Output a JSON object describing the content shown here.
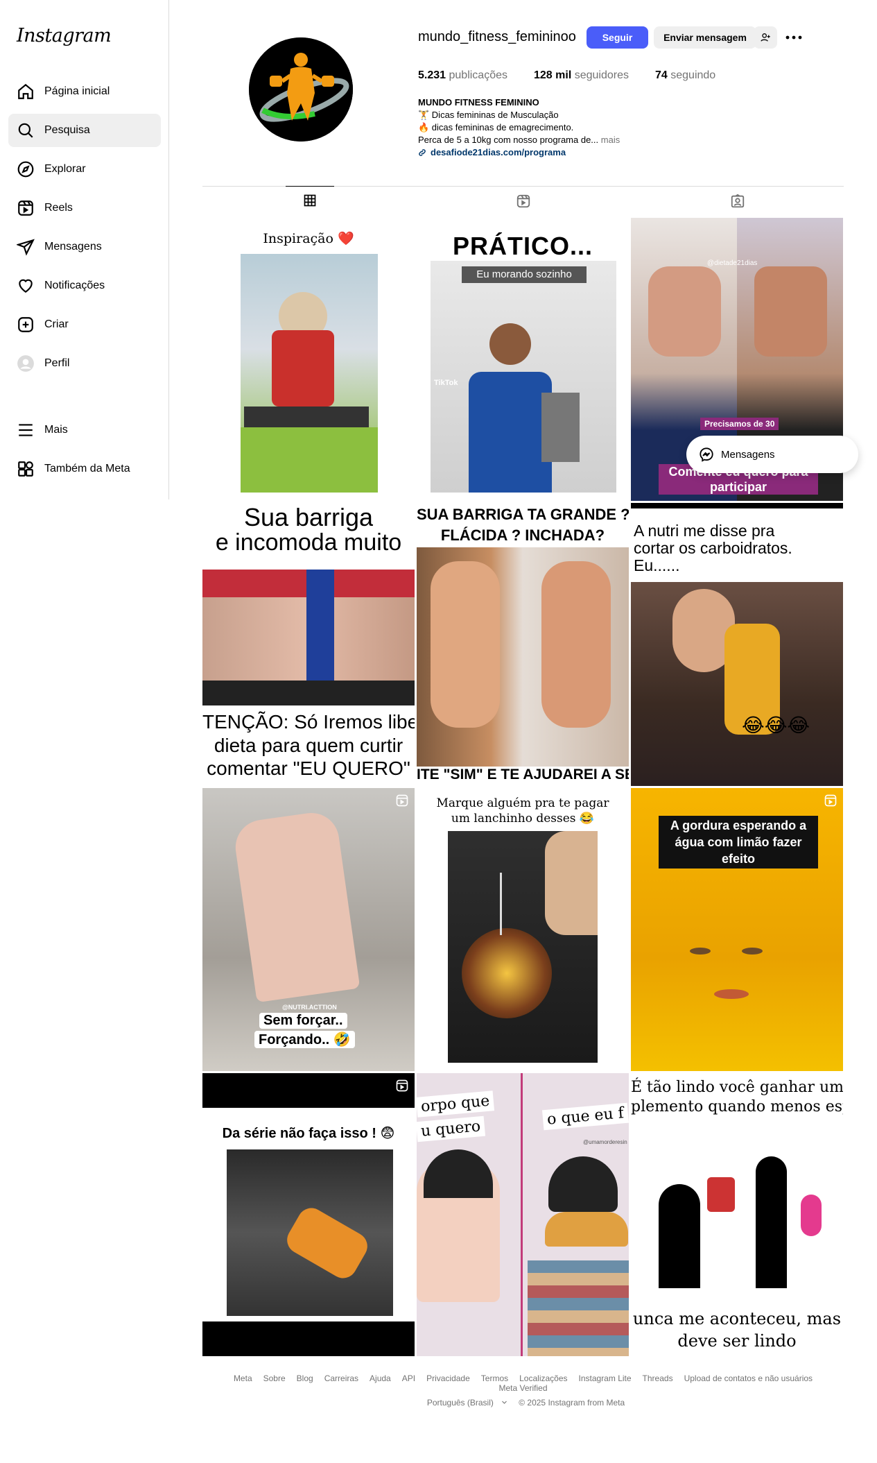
{
  "app": {
    "logo": "Instagram"
  },
  "sidebar": {
    "items": [
      {
        "label": "Página inicial",
        "icon": "home-icon"
      },
      {
        "label": "Pesquisa",
        "icon": "search-icon",
        "active": true
      },
      {
        "label": "Explorar",
        "icon": "compass-icon"
      },
      {
        "label": "Reels",
        "icon": "reels-icon"
      },
      {
        "label": "Mensagens",
        "icon": "paper-plane-icon"
      },
      {
        "label": "Notificações",
        "icon": "heart-icon"
      },
      {
        "label": "Criar",
        "icon": "plus-square-icon"
      },
      {
        "label": "Perfil",
        "icon": "avatar-icon"
      }
    ],
    "bottom": [
      {
        "label": "Mais",
        "icon": "menu-icon"
      },
      {
        "label": "Também da Meta",
        "icon": "meta-grid-icon"
      }
    ]
  },
  "profile": {
    "username": "mundo_fitness_femininoo",
    "follow_label": "Seguir",
    "message_label": "Enviar mensagem",
    "stats": {
      "posts_value": "5.231",
      "posts_label": "publicações",
      "followers_value": "128 mil",
      "followers_label": "seguidores",
      "following_value": "74",
      "following_label": "seguindo"
    },
    "bio": {
      "name": "MUNDO FITNESS FEMININO",
      "line1": "🏋️ Dicas femininas de Musculação",
      "line2": "🔥 dicas femininas de emagrecimento.",
      "line3": "Perca de 5 a 10kg com nosso programa de...",
      "more": "mais",
      "link": "desafiode21dias.com/programa"
    }
  },
  "posts": [
    {
      "caption": "Inspiração ❤️"
    },
    {
      "caption": "PRÁTICO...",
      "sub": "Eu morando sozinho",
      "tag": "TikTok"
    },
    {
      "caption": "@dietade21dias",
      "overlay1": "Precisamos de 30",
      "overlay2": "Comente eu quero para participar"
    },
    {
      "caption": "Sua barriga",
      "line2": "e incomoda muito",
      "bottom1": "TENÇÃO: Só Iremos liber",
      "bottom2": "dieta para quem curtir",
      "bottom3": "comentar \"EU QUERO\""
    },
    {
      "caption": "SUA BARRIGA TA GRANDE ?",
      "line2": "FLÁCIDA ? INCHADA?",
      "bottom1": "ITE \"SIM\" E TE AJUDAREI A SEC"
    },
    {
      "caption": "A nutri me disse pra",
      "line2": "cortar os carboidratos.",
      "line3": "Eu......",
      "emoji": "😂😂😂"
    },
    {
      "tag": "@NUTRI.ACTTION",
      "caption": "Sem forçar..",
      "line2": "Forçando.. 🤣"
    },
    {
      "caption": "Marque alguém pra te pagar",
      "line2": "um lanchinho desses 😂"
    },
    {
      "caption": "A gordura esperando a",
      "line2": "água com limão fazer efeito"
    },
    {
      "caption": "Da série não faça isso ! 😨"
    },
    {
      "caption": "orpo que",
      "line2": "u quero",
      "right": "o que eu f",
      "tag": "@umamorderesin"
    },
    {
      "caption": "É tão lindo você ganhar um",
      "line2": "plemento quando menos espe",
      "bottom1": "unca me aconteceu, mas",
      "bottom2": "deve ser lindo"
    }
  ],
  "floating": {
    "messages_label": "Mensagens"
  },
  "footer": {
    "links": [
      "Meta",
      "Sobre",
      "Blog",
      "Carreiras",
      "Ajuda",
      "API",
      "Privacidade",
      "Termos",
      "Localizações",
      "Instagram Lite",
      "Threads",
      "Upload de contatos e não usuários",
      "Meta Verified"
    ],
    "language": "Português (Brasil)",
    "copyright": "© 2025 Instagram from Meta"
  },
  "colors": {
    "accent": "#4a5df9",
    "link": "#00376b",
    "muted": "#737373"
  }
}
